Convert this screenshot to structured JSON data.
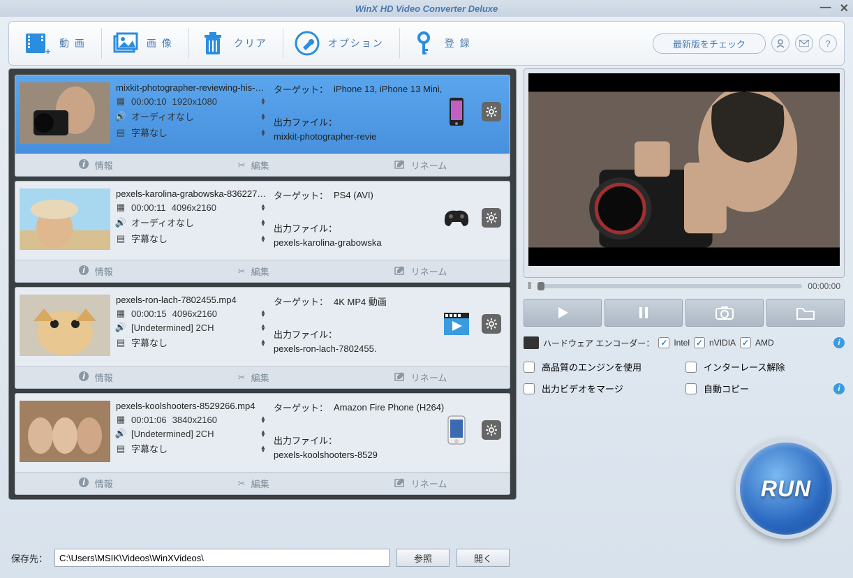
{
  "app_title": "WinX HD Video Converter Deluxe",
  "toolbar": {
    "video": "動 画",
    "image": "画 像",
    "clear": "クリア",
    "options": "オプション",
    "register": "登 録",
    "check_update": "最新版をチェック"
  },
  "files": [
    {
      "name": "mixkit-photographer-reviewing-his-sho",
      "duration": "00:00:10",
      "resolution": "1920x1080",
      "audio": "オーディオなし",
      "subtitle": "字幕なし",
      "target_label": "ターゲット：",
      "target_value": "iPhone 13, iPhone 13 Mini,",
      "output_label": "出力ファイル：",
      "output_value": "mixkit-photographer-revie",
      "selected": true,
      "device": "phone"
    },
    {
      "name": "pexels-karolina-grabowska-8362274.m",
      "duration": "00:00:11",
      "resolution": "4096x2160",
      "audio": "オーディオなし",
      "subtitle": "字幕なし",
      "target_label": "ターゲット：",
      "target_value": "PS4 (AVI)",
      "output_label": "出力ファイル：",
      "output_value": "pexels-karolina-grabowska",
      "selected": false,
      "device": "gamepad"
    },
    {
      "name": "pexels-ron-lach-7802455.mp4",
      "duration": "00:00:15",
      "resolution": "4096x2160",
      "audio": "[Undetermined] 2CH",
      "subtitle": "字幕なし",
      "target_label": "ターゲット：",
      "target_value": "4K MP4 動画",
      "output_label": "出力ファイル：",
      "output_value": "pexels-ron-lach-7802455.",
      "selected": false,
      "device": "video"
    },
    {
      "name": "pexels-koolshooters-8529266.mp4",
      "duration": "00:01:06",
      "resolution": "3840x2160",
      "audio": "[Undetermined] 2CH",
      "subtitle": "字幕なし",
      "target_label": "ターゲット：",
      "target_value": "Amazon Fire Phone (H264)",
      "output_label": "出力ファイル：",
      "output_value": "pexels-koolshooters-8529",
      "selected": false,
      "device": "phone2"
    }
  ],
  "item_actions": {
    "info": "情報",
    "edit": "編集",
    "rename": "リネーム"
  },
  "preview": {
    "time": "00:00:00"
  },
  "hardware": {
    "label": "ハードウェア エンコーダー：",
    "intel": "Intel",
    "nvidia": "nVIDIA",
    "amd": "AMD"
  },
  "options": {
    "hq_engine": "高品質のエンジンを使用",
    "deinterlace": "インターレース解除",
    "merge": "出力ビデオをマージ",
    "autocopy": "自動コピー"
  },
  "run_label": "RUN",
  "bottom": {
    "save_to": "保存先：",
    "path": "C:\\Users\\MSIK\\Videos\\WinXVideos\\",
    "browse": "参照",
    "open": "開く"
  }
}
